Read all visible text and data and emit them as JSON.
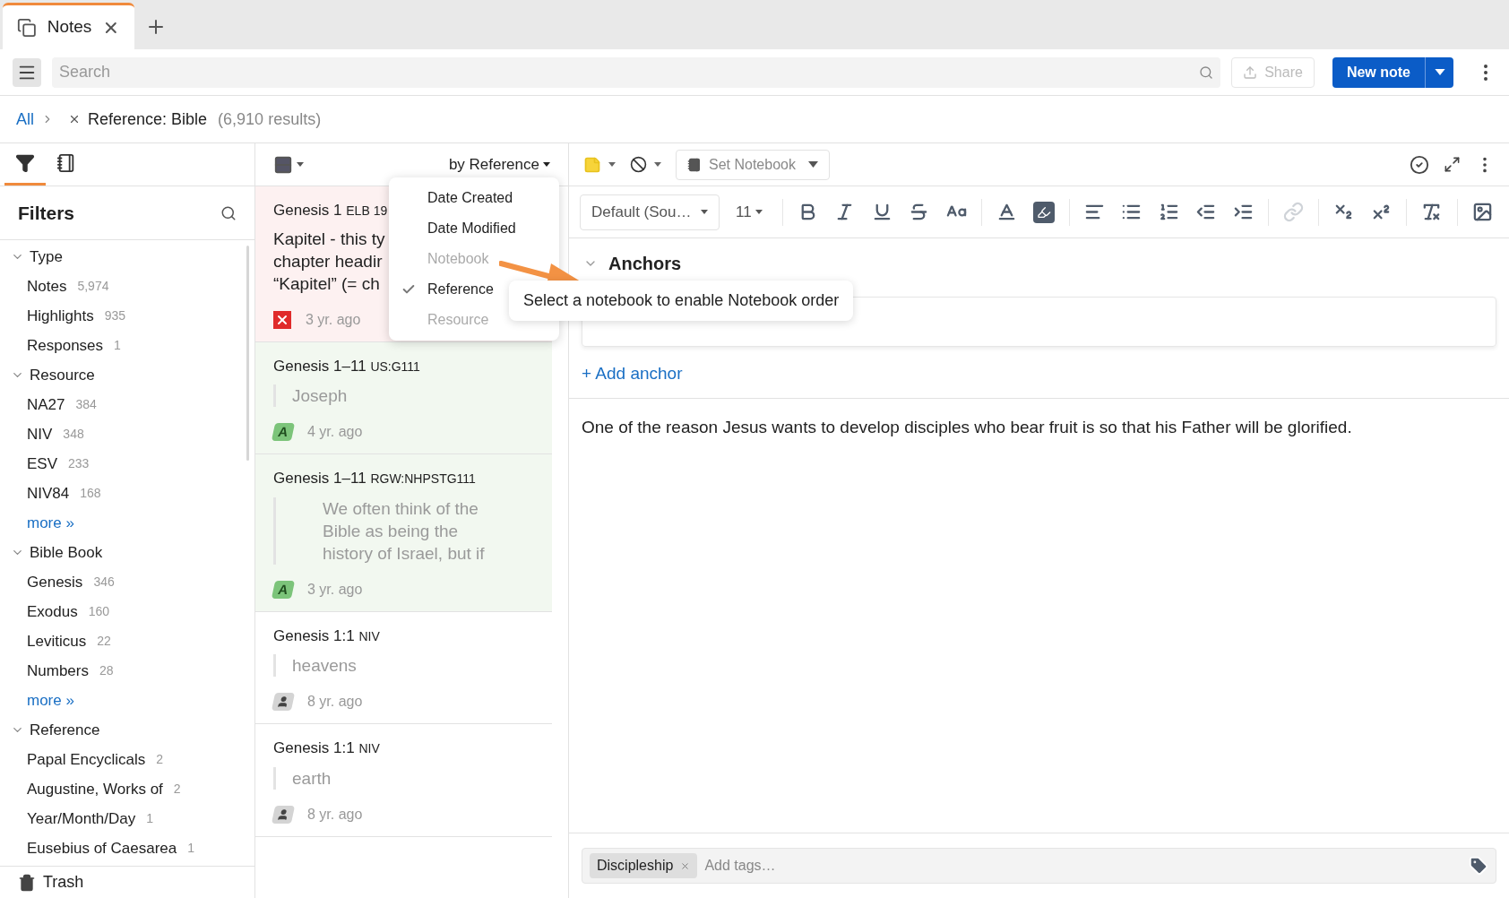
{
  "tabs": [
    {
      "label": "Notes",
      "selected": true
    }
  ],
  "search": {
    "placeholder": "Search"
  },
  "share": {
    "label": "Share",
    "disabled": true
  },
  "new_note": {
    "label": "New note"
  },
  "breadcrumb": {
    "root": "All",
    "filter": "Reference: Bible",
    "count": "(6,910 results)"
  },
  "sidebar": {
    "tabs": [
      {
        "kind": "filter",
        "selected": true
      },
      {
        "kind": "notebook",
        "selected": false
      }
    ],
    "title": "Filters",
    "groups": [
      {
        "label": "Type",
        "expanded": true,
        "items": [
          {
            "label": "Notes",
            "count": "5,974"
          },
          {
            "label": "Highlights",
            "count": "935"
          },
          {
            "label": "Responses",
            "count": "1"
          }
        ]
      },
      {
        "label": "Resource",
        "expanded": true,
        "items": [
          {
            "label": "NA27",
            "count": "384"
          },
          {
            "label": "NIV",
            "count": "348"
          },
          {
            "label": "ESV",
            "count": "233"
          },
          {
            "label": "NIV84",
            "count": "168"
          }
        ],
        "more": "more »"
      },
      {
        "label": "Bible Book",
        "expanded": true,
        "items": [
          {
            "label": "Genesis",
            "count": "346"
          },
          {
            "label": "Exodus",
            "count": "160"
          },
          {
            "label": "Leviticus",
            "count": "22"
          },
          {
            "label": "Numbers",
            "count": "28"
          }
        ],
        "more": "more »"
      },
      {
        "label": "Reference",
        "expanded": true,
        "items": [
          {
            "label": "Papal Encyclicals",
            "count": "2"
          },
          {
            "label": "Augustine, Works of",
            "count": "2"
          },
          {
            "label": "Year/Month/Day",
            "count": "1"
          },
          {
            "label": "Eusebius of Caesarea",
            "count": "1"
          }
        ]
      }
    ],
    "trash": "Trash"
  },
  "list": {
    "sort": "by Reference",
    "sort_menu": [
      {
        "label": "Date Created",
        "disabled": false,
        "selected": false
      },
      {
        "label": "Date Modified",
        "disabled": false,
        "selected": false
      },
      {
        "label": "Notebook",
        "disabled": true,
        "selected": false
      },
      {
        "label": "Reference",
        "disabled": false,
        "selected": true
      },
      {
        "label": "Resource",
        "disabled": true,
        "selected": false
      }
    ],
    "tooltip": "Select a notebook to enable Notebook order",
    "notes": [
      {
        "kind": "error",
        "reference": "Genesis 1",
        "resource": "ELB 19",
        "body": [
          "Kapitel - this ty",
          "chapter headir",
          "“Kapitel” (= ch"
        ],
        "time": "3 yr. ago"
      },
      {
        "kind": "shared",
        "reference": "Genesis 1–11",
        "resource": "US:G111",
        "quote": [
          "Joseph"
        ],
        "badge": "A",
        "time": "4 yr. ago"
      },
      {
        "kind": "shared",
        "reference": "Genesis 1–11",
        "resource": "RGW:NHPSTG111",
        "quote": [
          "We often think of the",
          "Bible as being the",
          "history of Israel, but if"
        ],
        "badge": "A",
        "time": "3 yr. ago"
      },
      {
        "kind": "user",
        "reference": "Genesis 1:1",
        "resource": "NIV",
        "quote": [
          "heavens"
        ],
        "time": "8 yr. ago"
      },
      {
        "kind": "user",
        "reference": "Genesis 1:1",
        "resource": "NIV",
        "quote": [
          "earth"
        ],
        "time": "8 yr. ago"
      }
    ]
  },
  "editor": {
    "notebook": "Set Notebook",
    "font": "Default (Sou…",
    "size": "11",
    "format": [
      {
        "kind": "bold",
        "disabled": false
      },
      {
        "kind": "italic",
        "disabled": false
      },
      {
        "kind": "underline",
        "disabled": false
      },
      {
        "kind": "strike",
        "disabled": false
      },
      {
        "kind": "case",
        "disabled": false
      },
      {
        "kind": "color",
        "disabled": false
      },
      {
        "kind": "highlight",
        "disabled": false
      },
      {
        "kind": "align",
        "disabled": false
      },
      {
        "kind": "bullets",
        "disabled": false
      },
      {
        "kind": "numbers",
        "disabled": false
      },
      {
        "kind": "outdent",
        "disabled": false
      },
      {
        "kind": "indent",
        "disabled": false
      },
      {
        "kind": "link",
        "disabled": true
      },
      {
        "kind": "sub",
        "disabled": false
      },
      {
        "kind": "sup",
        "disabled": false
      },
      {
        "kind": "clear",
        "disabled": false
      },
      {
        "kind": "image",
        "disabled": false
      }
    ],
    "anchors": {
      "title": "Anchors",
      "expanded": true,
      "add": "+ Add anchor"
    },
    "body": "One of the reason Jesus wants to develop disciples who bear fruit is so that his Father will be glorified.",
    "tags": [
      {
        "label": "Discipleship"
      }
    ],
    "tag_placeholder": "Add tags…"
  }
}
